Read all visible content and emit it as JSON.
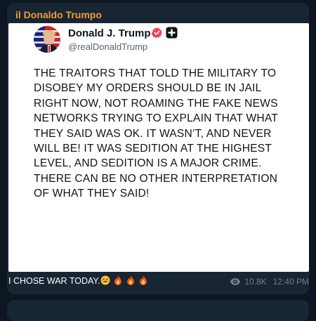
{
  "channel": {
    "name": "il Donaldo Trumpo"
  },
  "post": {
    "author_name": "Donald J. Trump",
    "handle": "@realDonaldTrump",
    "text": "THE TRAITORS THAT TOLD THE MILITARY TO DISOBEY MY ORDERS SHOULD BE IN JAIL RIGHT NOW, NOT ROAMING THE FAKE NEWS NETWORKS TRYING TO EXPLAIN THAT WHAT THEY SAID WAS OK. IT WASN’T, AND NEVER WILL BE! IT WAS SEDITION AT THE HIGHEST LEVEL, AND SEDITION IS A MAJOR CRIME. THERE CAN BE NO OTHER INTERPRETATION OF WHAT THEY SAID!"
  },
  "message": {
    "caption": "I CHOSE WAR TODAY.",
    "emojis": [
      "rofl-emoji",
      "fire-emoji",
      "fire-emoji",
      "fire-emoji"
    ],
    "views": "10.8K",
    "time": "12:40 PM"
  },
  "colors": {
    "background": "#0e1621",
    "bubble": "#182533",
    "channel_name": "#f09a37",
    "meta": "#6d7f8f",
    "verified_badge": "#f2435f"
  }
}
